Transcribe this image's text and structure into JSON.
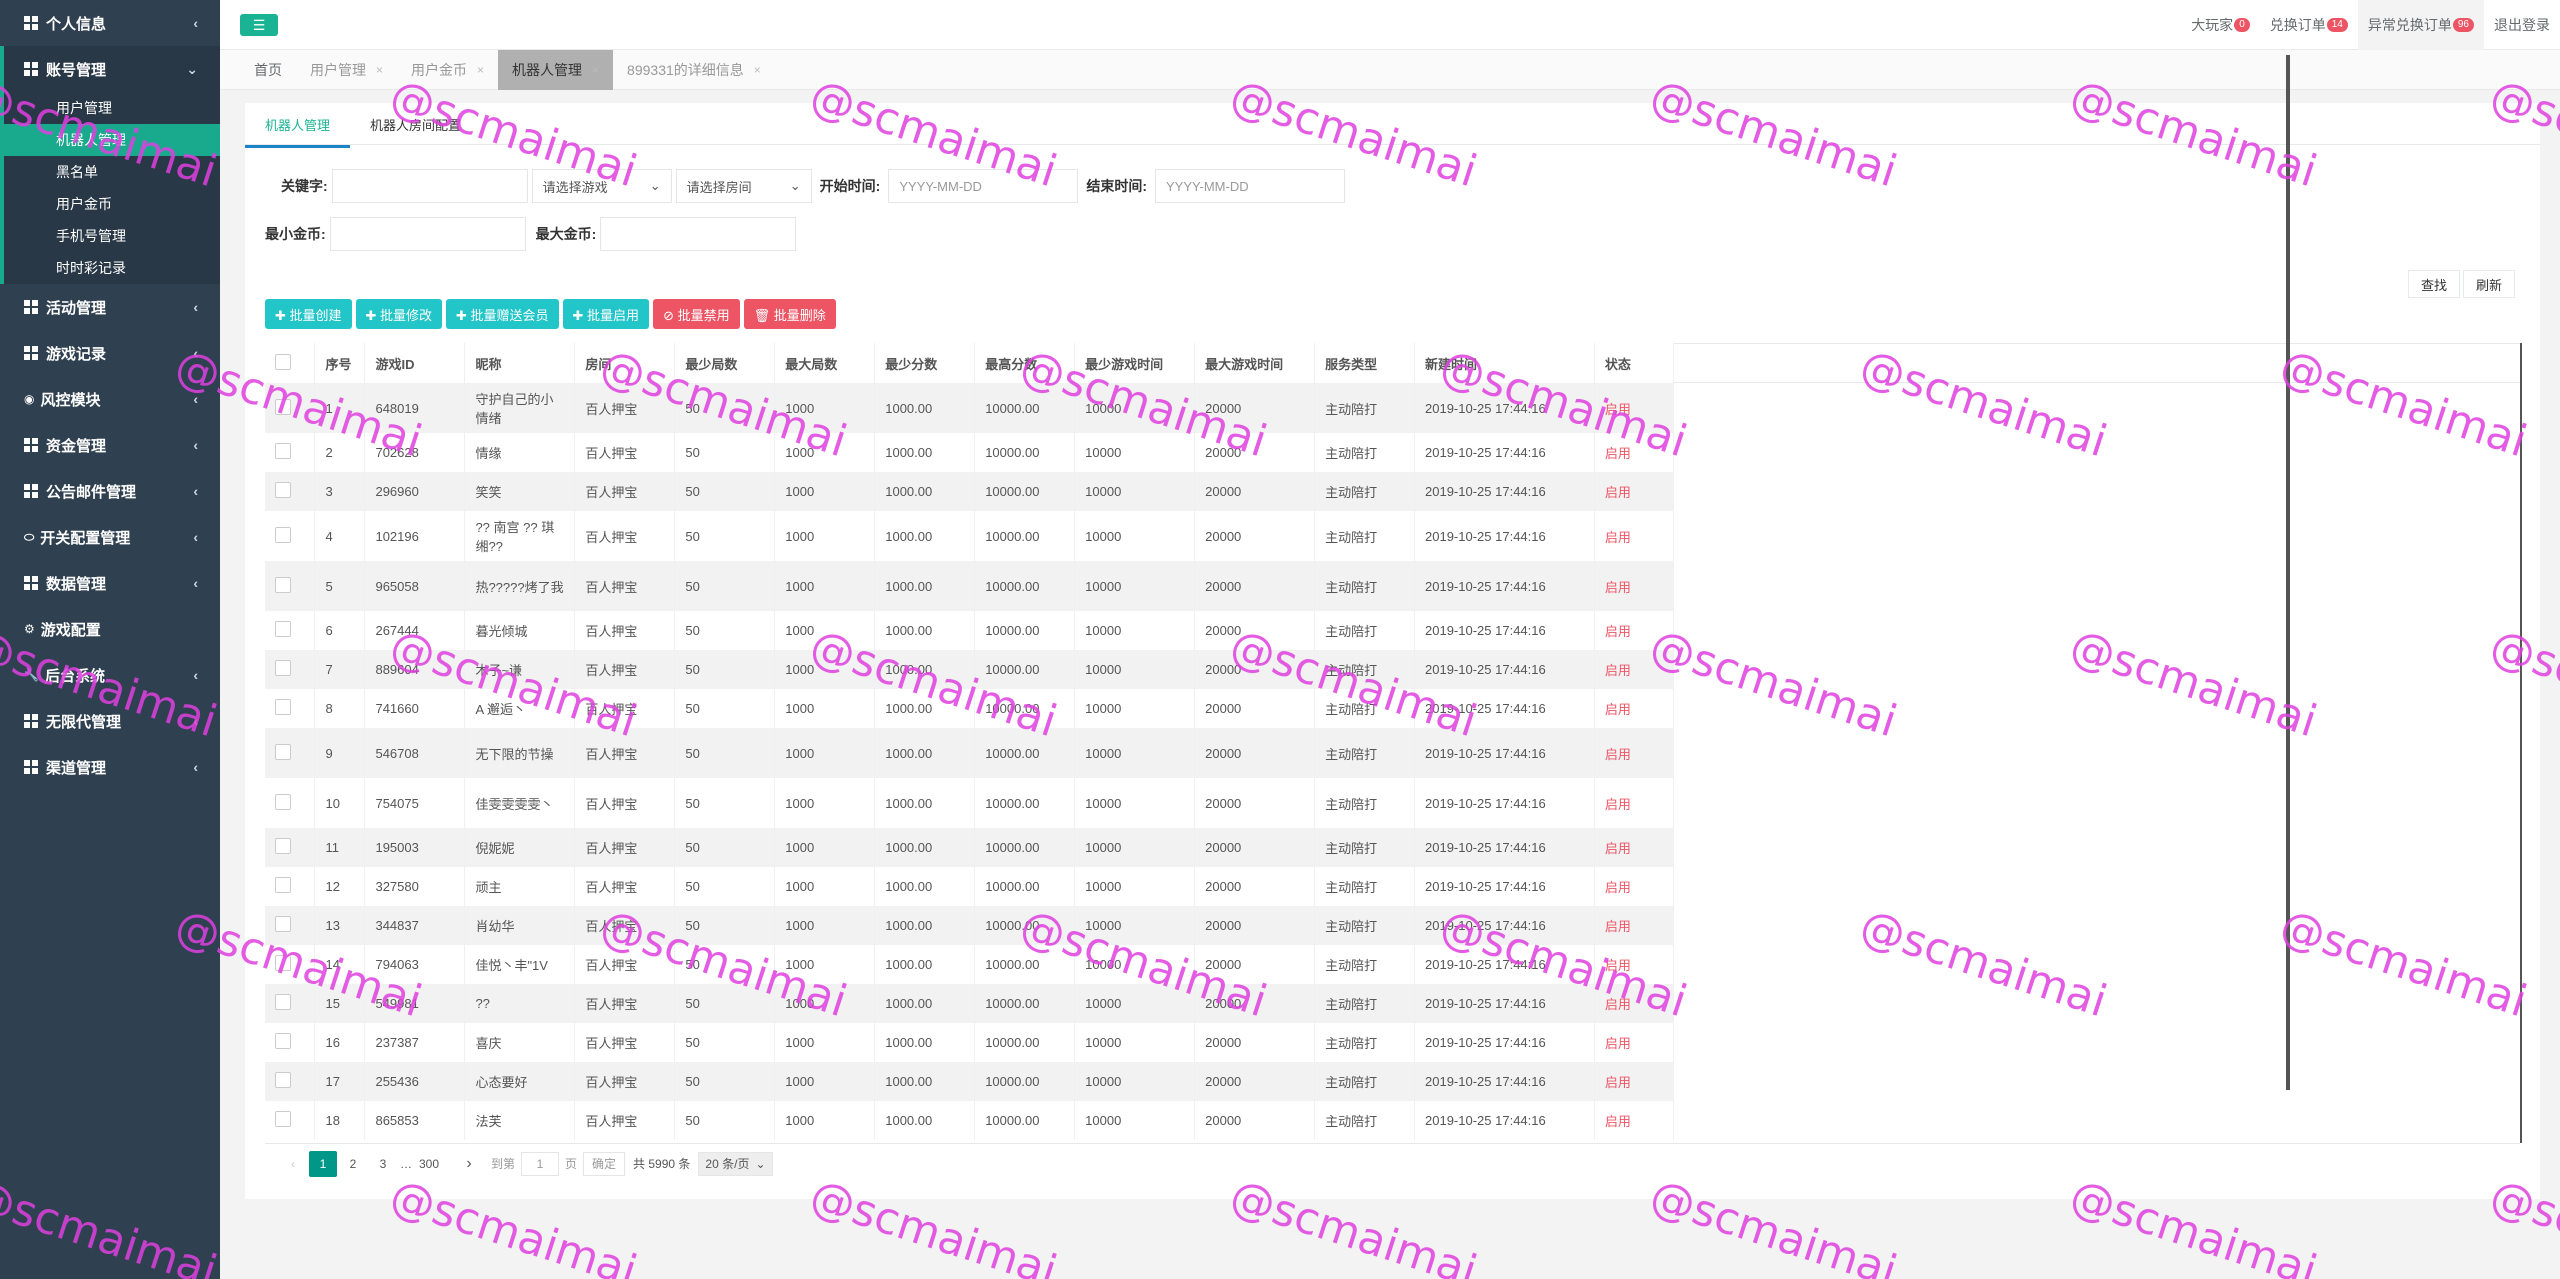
{
  "sidebar": {
    "groups": [
      {
        "label": "个人信息",
        "icon": "grid-icon",
        "chev": "‹"
      },
      {
        "label": "账号管理",
        "icon": "grid-icon",
        "chev": "⌄",
        "items": [
          "用户管理",
          "机器人管理",
          "黑名单",
          "用户金币",
          "手机号管理",
          "时时彩记录"
        ]
      },
      {
        "label": "活动管理",
        "icon": "grid-icon",
        "chev": "‹"
      },
      {
        "label": "游戏记录",
        "icon": "grid-icon",
        "chev": "‹"
      },
      {
        "label": "风控模块",
        "icon": "eye-icon",
        "chev": "‹"
      },
      {
        "label": "资金管理",
        "icon": "grid-icon",
        "chev": "‹"
      },
      {
        "label": "公告邮件管理",
        "icon": "grid-icon",
        "chev": "‹"
      },
      {
        "label": "开关配置管理",
        "icon": "toggle-icon",
        "chev": "‹"
      },
      {
        "label": "数据管理",
        "icon": "grid-icon",
        "chev": "‹"
      },
      {
        "label": "游戏配置",
        "icon": "gears-icon",
        "chev": ""
      },
      {
        "label": "后台系统",
        "icon": "wrench-icon",
        "chev": "‹"
      },
      {
        "label": "无限代管理",
        "icon": "grid-icon",
        "chev": "‹"
      },
      {
        "label": "渠道管理",
        "icon": "grid-icon",
        "chev": "‹"
      }
    ]
  },
  "topbar": {
    "toggle": "☰",
    "links": [
      {
        "label": "大玩家",
        "badge": "0"
      },
      {
        "label": "兑换订单",
        "badge": "14"
      },
      {
        "label": "异常兑换订单",
        "badge": "96"
      },
      {
        "label": "退出登录",
        "badge": ""
      }
    ]
  },
  "tabs": [
    {
      "label": "首页",
      "close": ""
    },
    {
      "label": "用户管理",
      "close": "×"
    },
    {
      "label": "用户金币",
      "close": "×"
    },
    {
      "label": "机器人管理",
      "close": "×"
    },
    {
      "label": "899331的详细信息",
      "close": "×"
    }
  ],
  "subtabs": [
    "机器人管理",
    "机器人房间配置"
  ],
  "filters": {
    "keyword_label": "关键字:",
    "game_placeholder": "请选择游戏",
    "room_placeholder": "请选择房间",
    "start_label": "开始时间:",
    "start_placeholder": "YYYY-MM-DD",
    "end_label": "结束时间:",
    "end_placeholder": "YYYY-MM-DD",
    "min_coin_label": "最小金币:",
    "max_coin_label": "最大金币:",
    "search_btn": "查找",
    "refresh_btn": "刷新"
  },
  "actions": [
    {
      "label": "✚ 批量创建",
      "color": "#23c6c8"
    },
    {
      "label": "✚ 批量修改",
      "color": "#23c6c8"
    },
    {
      "label": "✚ 批量赠送会员",
      "color": "#23c6c8"
    },
    {
      "label": "✚ 批量启用",
      "color": "#23c6c8"
    },
    {
      "label": "⊘ 批量禁用",
      "color": "#ed5565"
    },
    {
      "label": "🗑 批量删除",
      "color": "#ed5565"
    }
  ],
  "table": {
    "columns": [
      "",
      "序号",
      "游戏ID",
      "昵称",
      "房间",
      "最少局数",
      "最大局数",
      "最少分数",
      "最高分数",
      "最少游戏时间",
      "最大游戏时间",
      "服务类型",
      "新建时间",
      "状态"
    ],
    "rows": [
      [
        "1",
        "648019",
        "守护自己的小情绪",
        "百人押宝",
        "50",
        "1000",
        "1000.00",
        "10000.00",
        "10000",
        "20000",
        "主动陪打",
        "2019-10-25 17:44:16",
        "启用"
      ],
      [
        "2",
        "702628",
        "情缘",
        "百人押宝",
        "50",
        "1000",
        "1000.00",
        "10000.00",
        "10000",
        "20000",
        "主动陪打",
        "2019-10-25 17:44:16",
        "启用"
      ],
      [
        "3",
        "296960",
        "笑笑",
        "百人押宝",
        "50",
        "1000",
        "1000.00",
        "10000.00",
        "10000",
        "20000",
        "主动陪打",
        "2019-10-25 17:44:16",
        "启用"
      ],
      [
        "4",
        "102196",
        "?? 南宫 ?? 琪缃??",
        "百人押宝",
        "50",
        "1000",
        "1000.00",
        "10000.00",
        "10000",
        "20000",
        "主动陪打",
        "2019-10-25 17:44:16",
        "启用"
      ],
      [
        "5",
        "965058",
        "热?????烤了我",
        "百人押宝",
        "50",
        "1000",
        "1000.00",
        "10000.00",
        "10000",
        "20000",
        "主动陪打",
        "2019-10-25 17:44:16",
        "启用"
      ],
      [
        "6",
        "267444",
        "暮光倾城",
        "百人押宝",
        "50",
        "1000",
        "1000.00",
        "10000.00",
        "10000",
        "20000",
        "主动陪打",
        "2019-10-25 17:44:16",
        "启用"
      ],
      [
        "7",
        "889604",
        "木子~谦",
        "百人押宝",
        "50",
        "1000",
        "1000.00",
        "10000.00",
        "10000",
        "20000",
        "主动陪打",
        "2019-10-25 17:44:16",
        "启用"
      ],
      [
        "8",
        "741660",
        "A 邂逅丶",
        "百人押宝",
        "50",
        "1000",
        "1000.00",
        "10000.00",
        "10000",
        "20000",
        "主动陪打",
        "2019-10-25 17:44:16",
        "启用"
      ],
      [
        "9",
        "546708",
        "无下限的节操",
        "百人押宝",
        "50",
        "1000",
        "1000.00",
        "10000.00",
        "10000",
        "20000",
        "主动陪打",
        "2019-10-25 17:44:16",
        "启用"
      ],
      [
        "10",
        "754075",
        "佳雯雯雯雯丶",
        "百人押宝",
        "50",
        "1000",
        "1000.00",
        "10000.00",
        "10000",
        "20000",
        "主动陪打",
        "2019-10-25 17:44:16",
        "启用"
      ],
      [
        "11",
        "195003",
        "倪妮妮",
        "百人押宝",
        "50",
        "1000",
        "1000.00",
        "10000.00",
        "10000",
        "20000",
        "主动陪打",
        "2019-10-25 17:44:16",
        "启用"
      ],
      [
        "12",
        "327580",
        "顽主",
        "百人押宝",
        "50",
        "1000",
        "1000.00",
        "10000.00",
        "10000",
        "20000",
        "主动陪打",
        "2019-10-25 17:44:16",
        "启用"
      ],
      [
        "13",
        "344837",
        "肖幼华",
        "百人押宝",
        "50",
        "1000",
        "1000.00",
        "10000.00",
        "10000",
        "20000",
        "主动陪打",
        "2019-10-25 17:44:16",
        "启用"
      ],
      [
        "14",
        "794063",
        "佳悦丶丰\"1V",
        "百人押宝",
        "50",
        "1000",
        "1000.00",
        "10000.00",
        "10000",
        "20000",
        "主动陪打",
        "2019-10-25 17:44:16",
        "启用"
      ],
      [
        "15",
        "549981",
        "??",
        "百人押宝",
        "50",
        "1000",
        "1000.00",
        "10000.00",
        "10000",
        "20000",
        "主动陪打",
        "2019-10-25 17:44:16",
        "启用"
      ],
      [
        "16",
        "237387",
        "喜庆",
        "百人押宝",
        "50",
        "1000",
        "1000.00",
        "10000.00",
        "10000",
        "20000",
        "主动陪打",
        "2019-10-25 17:44:16",
        "启用"
      ],
      [
        "17",
        "255436",
        "心态要好",
        "百人押宝",
        "50",
        "1000",
        "1000.00",
        "10000.00",
        "10000",
        "20000",
        "主动陪打",
        "2019-10-25 17:44:16",
        "启用"
      ],
      [
        "18",
        "865853",
        "法芙",
        "百人押宝",
        "50",
        "1000",
        "1000.00",
        "10000.00",
        "10000",
        "20000",
        "主动陪打",
        "2019-10-25 17:44:16",
        "启用"
      ]
    ]
  },
  "pager": {
    "prev": "‹",
    "pages": [
      "1",
      "2",
      "3"
    ],
    "ellipsis": "…",
    "last": "300",
    "next": "›",
    "goto_label": "到第",
    "goto_value": "1",
    "page_unit": "页",
    "confirm": "确定",
    "total": "共 5990 条",
    "page_size": "20 条/页"
  },
  "watermark": "@scmaimai",
  "colors": {
    "sidebar": "#2f4050",
    "accent": "#1ab394",
    "active_item": "#19aa8d",
    "danger": "#ed5565",
    "info": "#23c6c8",
    "watermark": "#e040e0"
  }
}
